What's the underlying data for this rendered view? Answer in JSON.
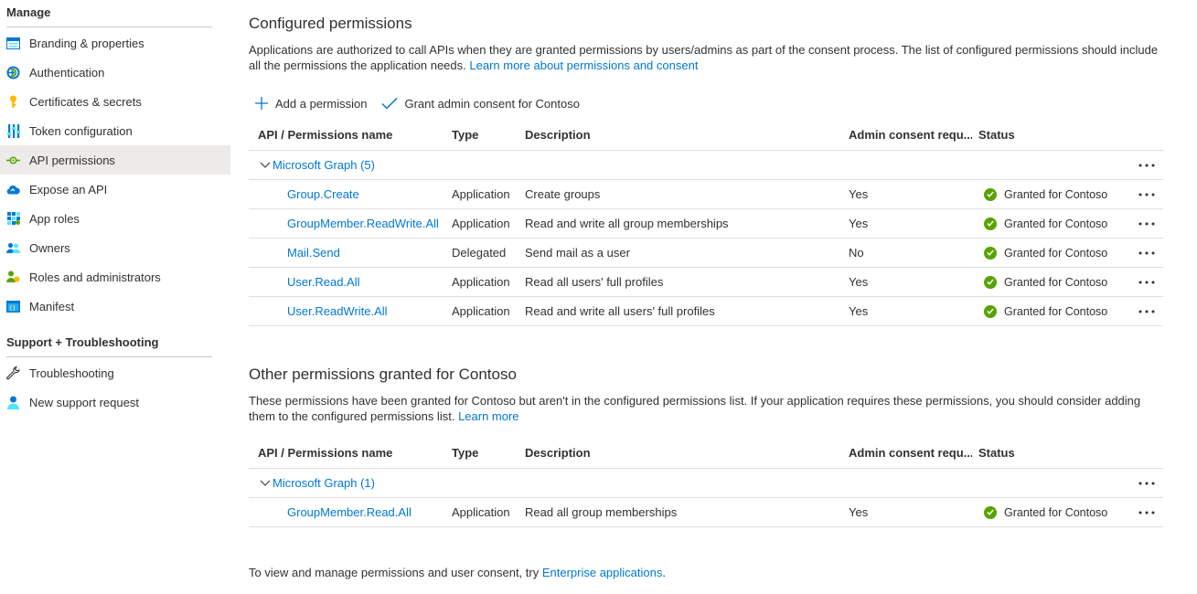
{
  "sidebar": {
    "manage_heading": "Manage",
    "manage_items": [
      {
        "label": "Branding & properties",
        "icon": "branding-icon"
      },
      {
        "label": "Authentication",
        "icon": "authentication-icon"
      },
      {
        "label": "Certificates & secrets",
        "icon": "key-icon"
      },
      {
        "label": "Token configuration",
        "icon": "token-icon"
      },
      {
        "label": "API permissions",
        "icon": "api-permissions-icon",
        "active": true
      },
      {
        "label": "Expose an API",
        "icon": "cloud-icon"
      },
      {
        "label": "App roles",
        "icon": "app-roles-icon"
      },
      {
        "label": "Owners",
        "icon": "owners-icon"
      },
      {
        "label": "Roles and administrators",
        "icon": "roles-icon"
      },
      {
        "label": "Manifest",
        "icon": "manifest-icon"
      }
    ],
    "support_heading": "Support + Troubleshooting",
    "support_items": [
      {
        "label": "Troubleshooting",
        "icon": "wrench-icon"
      },
      {
        "label": "New support request",
        "icon": "support-person-icon"
      }
    ]
  },
  "configured": {
    "title": "Configured permissions",
    "description": "Applications are authorized to call APIs when they are granted permissions by users/admins as part of the consent process. The list of configured permissions should include all the permissions the application needs.",
    "learn_more": "Learn more about permissions and consent",
    "toolbar": {
      "add_label": "Add a permission",
      "grant_label": "Grant admin consent for Contoso"
    },
    "columns": {
      "name": "API / Permissions name",
      "type": "Type",
      "description": "Description",
      "admin": "Admin consent requ...",
      "status": "Status"
    },
    "group": "Microsoft Graph (5)",
    "rows": [
      {
        "name": "Group.Create",
        "type": "Application",
        "description": "Create groups",
        "admin": "Yes",
        "status": "Granted for Contoso"
      },
      {
        "name": "GroupMember.ReadWrite.All",
        "type": "Application",
        "description": "Read and write all group memberships",
        "admin": "Yes",
        "status": "Granted for Contoso"
      },
      {
        "name": "Mail.Send",
        "type": "Delegated",
        "description": "Send mail as a user",
        "admin": "No",
        "status": "Granted for Contoso"
      },
      {
        "name": "User.Read.All",
        "type": "Application",
        "description": "Read all users' full profiles",
        "admin": "Yes",
        "status": "Granted for Contoso"
      },
      {
        "name": "User.ReadWrite.All",
        "type": "Application",
        "description": "Read and write all users' full profiles",
        "admin": "Yes",
        "status": "Granted for Contoso"
      }
    ]
  },
  "other": {
    "title": "Other permissions granted for Contoso",
    "description": "These permissions have been granted for Contoso but aren't in the configured permissions list. If your application requires these permissions, you should consider adding them to the configured permissions list.",
    "learn_more": "Learn more",
    "columns": {
      "name": "API / Permissions name",
      "type": "Type",
      "description": "Description",
      "admin": "Admin consent requ...",
      "status": "Status"
    },
    "group": "Microsoft Graph (1)",
    "rows": [
      {
        "name": "GroupMember.Read.All",
        "type": "Application",
        "description": "Read all group memberships",
        "admin": "Yes",
        "status": "Granted for Contoso"
      }
    ]
  },
  "footer": {
    "text": "To view and manage permissions and user consent, try",
    "link": "Enterprise applications",
    "suffix": "."
  },
  "colors": {
    "link": "#0078d4",
    "granted": "#57a300",
    "active_nav": "#edebe9"
  }
}
